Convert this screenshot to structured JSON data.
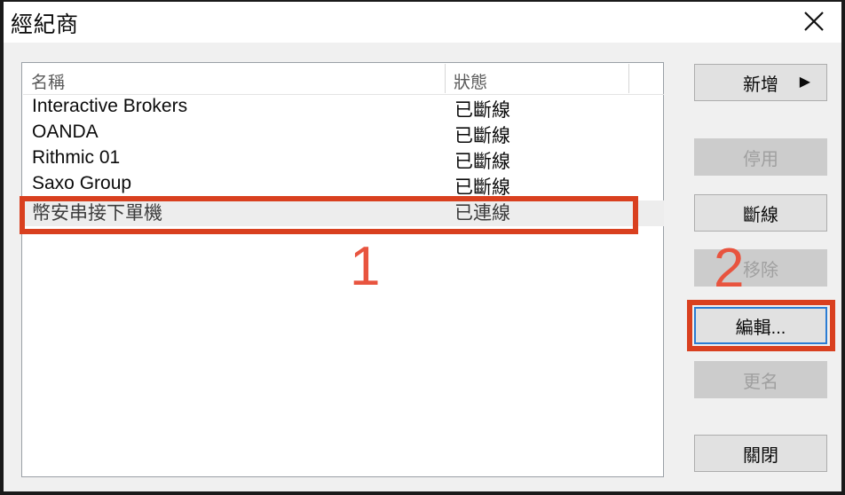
{
  "window": {
    "title": "經紀商",
    "close_icon": "close-x-icon"
  },
  "list": {
    "columns": [
      "名稱",
      "狀態"
    ],
    "rows": [
      {
        "name": "Interactive Brokers",
        "state": "已斷線",
        "selected": false
      },
      {
        "name": "OANDA",
        "state": "已斷線",
        "selected": false
      },
      {
        "name": "Rithmic 01",
        "state": "已斷線",
        "selected": false
      },
      {
        "name": "Saxo Group",
        "state": "已斷線",
        "selected": false
      },
      {
        "name": "幣安串接下單機",
        "state": "已連線",
        "selected": true
      }
    ]
  },
  "buttons": {
    "add": {
      "label": "新增",
      "arrow": "▶",
      "state": "enabled"
    },
    "disable": {
      "label": "停用",
      "state": "disabled"
    },
    "disconnect": {
      "label": "斷線",
      "state": "enabled"
    },
    "remove": {
      "label": "移除",
      "state": "disabled"
    },
    "edit": {
      "label": "編輯...",
      "state": "focused"
    },
    "rename": {
      "label": "更名",
      "state": "disabled"
    },
    "close": {
      "label": "關閉",
      "state": "enabled"
    }
  },
  "annotations": {
    "step_one": "1",
    "step_two": "2",
    "color": "#d9401f",
    "number_color": "#e8543f"
  }
}
